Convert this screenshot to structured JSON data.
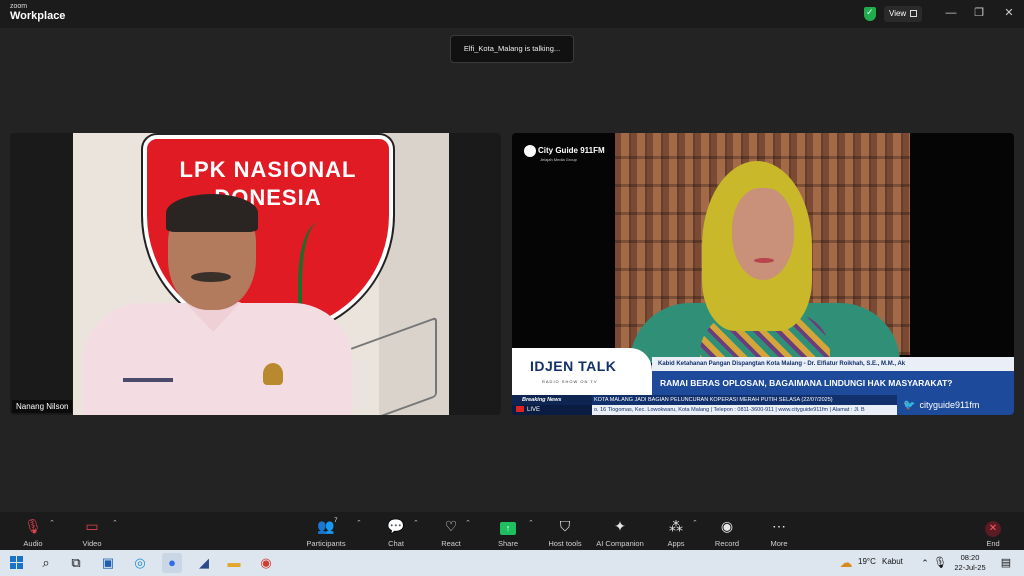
{
  "app": {
    "brand_small": "zoom",
    "brand_big": "Workplace"
  },
  "titlebar": {
    "view_label": "View"
  },
  "toast": {
    "text": "Elfi_Kota_Malang is talking..."
  },
  "participants": {
    "left_name": "Nanang Nilson"
  },
  "left_video": {
    "badge_line1": "LPK NASIONAL",
    "badge_line2": "DONESIA"
  },
  "right_video": {
    "logo": "City Guide 911FM",
    "logo_sub": "Jelajah Media Group",
    "show_title": "IDJEN TALK",
    "show_sub": "RADIO SHOW ON TV",
    "speaker_line": "Kabid Ketahanan Pangan Dispangtan Kota Malang - Dr. Elfiatur Roikhah, S.E., M.M., Ak",
    "headline": "RAMAI BERAS OPLOSAN, BAGAIMANA LINDUNGI HAK MASYARAKAT?",
    "breaking": "Breaking News",
    "live": "LIVE",
    "ticker1": "KOTA MALANG JADI BAGIAN PELUNCURAN KOPERASI MERAH PUTIH    SELASA (22/07/2025)",
    "ticker2": "o. 16 Tlogomas, Kec. Lowokwaru, Kota Malang | Telepon : 0811-3600-911 | www.cityguide911fm | Alamat : Jl. B",
    "social": "cityguide911fm"
  },
  "toolbar": {
    "audio": "Audio",
    "video": "Video",
    "participants": "Participants",
    "participants_count": "7",
    "chat": "Chat",
    "react": "React",
    "share": "Share",
    "host_tools": "Host tools",
    "ai_companion": "AI Companion",
    "apps": "Apps",
    "record": "Record",
    "more": "More",
    "end": "End"
  },
  "taskbar": {
    "weather_temp": "19°C",
    "weather_text": "Kabut",
    "time": "08:20",
    "date": "22-Jul-25"
  }
}
